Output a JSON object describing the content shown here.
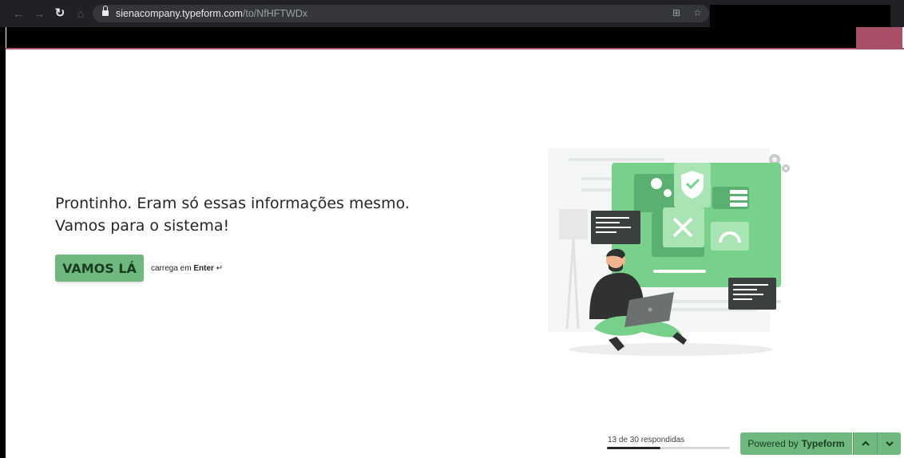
{
  "browser": {
    "url_host": "sienacompany.typeform.com",
    "url_path": "/to/NfHFTWDx",
    "back_icon": "arrow-left-icon",
    "forward_icon": "arrow-right-icon",
    "reload_icon": "reload-icon",
    "home_icon": "home-icon",
    "lock_icon": "lock-icon",
    "accent_color": "#a94f67"
  },
  "question": {
    "line1": "Prontinho. Eram só essas informações mesmo.",
    "line2": "Vamos para o sistema!"
  },
  "cta": {
    "label": "VAMOS LÁ",
    "hint_prefix": "carrega em",
    "hint_key": "Enter",
    "hint_symbol": "↵",
    "color": "#6fb87f"
  },
  "footer": {
    "progress_text": "13 de 30 respondidas",
    "progress_fraction": 0.433,
    "powered_prefix": "Powered by",
    "powered_brand": "Typeform",
    "up_icon": "chevron-up-icon",
    "down_icon": "chevron-down-icon"
  }
}
